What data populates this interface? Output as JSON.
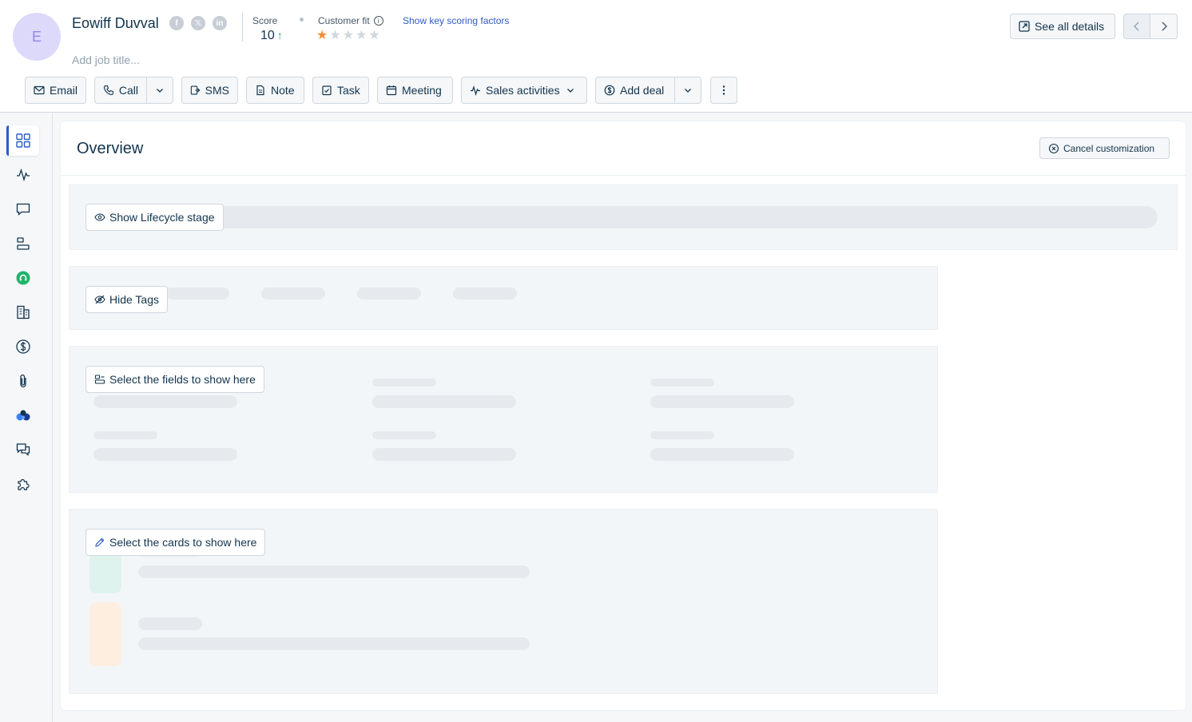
{
  "contact": {
    "avatar_initial": "E",
    "name": "Eowiff Duvval",
    "job_title_placeholder": "Add job title...",
    "socials": [
      {
        "glyph": "f"
      },
      {
        "glyph": "𝕏"
      },
      {
        "glyph": "in"
      }
    ]
  },
  "score": {
    "label": "Score",
    "value": "10",
    "trend": "↑"
  },
  "customer_fit": {
    "label": "Customer fit",
    "rating": 1,
    "max": 5,
    "info_glyph": "i"
  },
  "scoring_link": "Show key scoring factors",
  "header_buttons": {
    "see_all": "See all details"
  },
  "actions": {
    "email": "Email",
    "call": "Call",
    "sms": "SMS",
    "note": "Note",
    "task": "Task",
    "meeting": "Meeting",
    "sales_activities": "Sales activities",
    "add_deal": "Add deal"
  },
  "overview": {
    "title": "Overview",
    "cancel_label": "Cancel customization",
    "lifecycle_button": "Show Lifecycle stage",
    "tags_button": "Hide Tags",
    "fields_button": "Select the fields to show here",
    "cards_button": "Select the cards to show here"
  },
  "colors": {
    "accent": "#2c5cc5",
    "star_on": "#f08c37",
    "trend_up": "#00a886",
    "avatar_bg": "#dcd9fb"
  },
  "sidebar_icons": [
    "overview-icon",
    "activity-icon",
    "conversations-icon",
    "timeline-icon",
    "phone-app-icon",
    "accounts-icon",
    "deals-icon",
    "attachments-icon",
    "ai-assistant-icon",
    "chat-icon",
    "apps-icon"
  ]
}
